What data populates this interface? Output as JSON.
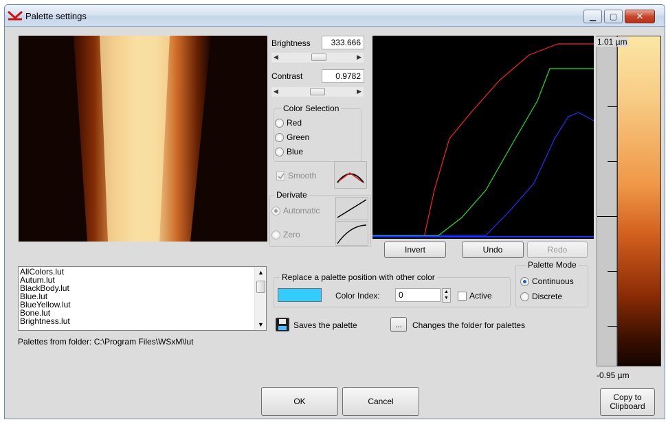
{
  "window": {
    "title": "Palette settings",
    "controls": {
      "minimize": "▁",
      "maximize": "▢",
      "close": "✕"
    }
  },
  "adjust": {
    "brightness_label": "Brightness",
    "brightness_value": "333.666",
    "brightness_slider": 0.52,
    "contrast_label": "Contrast",
    "contrast_value": "0.9782",
    "contrast_slider": 0.5
  },
  "color_selection": {
    "legend": "Color Selection",
    "options": [
      "Red",
      "Green",
      "Blue"
    ],
    "selected": null
  },
  "smooth": {
    "label": "Smooth",
    "checked": true,
    "enabled": false
  },
  "derivate": {
    "legend": "Derivate",
    "options": [
      "Automatic",
      "Zero"
    ],
    "selected": "Automatic",
    "enabled": false
  },
  "curve_buttons": {
    "invert": "Invert",
    "undo": "Undo",
    "redo": "Redo"
  },
  "palette_list": {
    "items": [
      "AllColors.lut",
      "Autum.lut",
      "BlackBody.lut",
      "Blue.lut",
      "BlueYellow.lut",
      "Bone.lut",
      "Brightness.lut"
    ],
    "folder_text": "Palettes from folder: C:\\Program Files\\WSxM\\lut"
  },
  "replace": {
    "legend": "Replace a palette position with other color",
    "color_index_label": "Color Index:",
    "color_index_value": "0",
    "active_label": "Active",
    "swatch_color": "#33ccff"
  },
  "palette_mode": {
    "legend": "Palette Mode",
    "options": [
      "Continuous",
      "Discrete"
    ],
    "selected": "Continuous"
  },
  "save": {
    "label": "Saves the palette"
  },
  "folder": {
    "button": "...",
    "label": "Changes the folder for palettes"
  },
  "scale": {
    "max_label": "1.01 µm",
    "min_label": "-0.95 µm"
  },
  "dialog_buttons": {
    "ok": "OK",
    "cancel": "Cancel",
    "copy_line1": "Copy to",
    "copy_line2": "Clipboard"
  },
  "colors": {
    "red_curve": "#ff2020",
    "green_curve": "#20e020",
    "blue_curve": "#2030ff",
    "palette_high": "#fbe6a5",
    "palette_low": "#140400"
  }
}
